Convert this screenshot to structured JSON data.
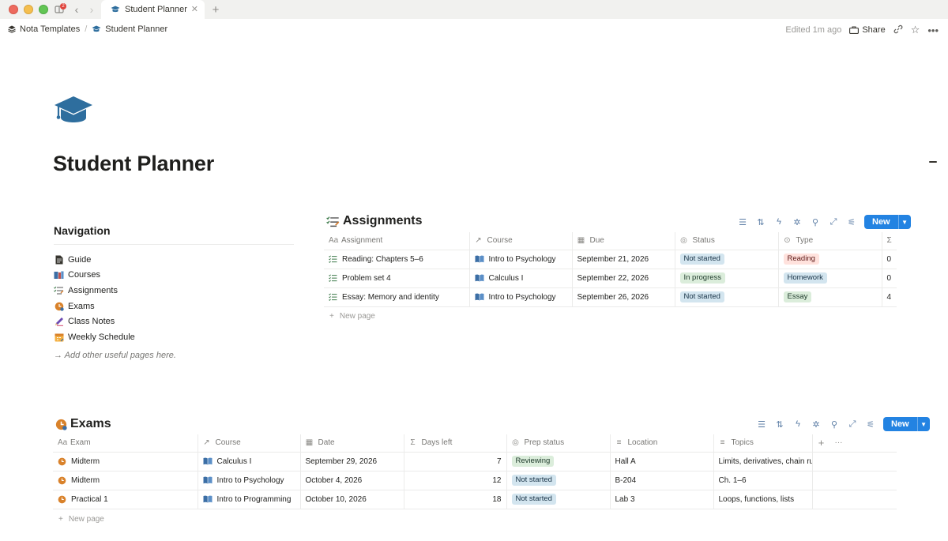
{
  "window": {
    "tab_title": "Student Planner",
    "notification_count": "2"
  },
  "breadcrumb": {
    "workspace": "Nota Templates",
    "page": "Student Planner"
  },
  "topbar": {
    "edited": "Edited 1m ago",
    "share_label": "Share"
  },
  "page": {
    "title": "Student Planner"
  },
  "navigation": {
    "heading": "Navigation",
    "items": [
      {
        "label": "Guide",
        "icon": "page-icon"
      },
      {
        "label": "Courses",
        "icon": "books-icon"
      },
      {
        "label": "Assignments",
        "icon": "checklist-icon"
      },
      {
        "label": "Exams",
        "icon": "exam-clock-icon"
      },
      {
        "label": "Class Notes",
        "icon": "pencil-icon"
      },
      {
        "label": "Weekly Schedule",
        "icon": "calendar-icon"
      }
    ],
    "hint": "→ Add other useful pages here."
  },
  "assignments": {
    "title": "Assignments",
    "new_label": "New",
    "new_page_label": "New page",
    "columns": [
      "Assignment",
      "Course",
      "Due",
      "Status",
      "Type",
      "Σ"
    ],
    "rows": [
      {
        "name": "Reading: Chapters 5–6",
        "course": "Intro to Psychology",
        "due": "September 21, 2026",
        "status": "Not started",
        "status_color": "#d3e5ef",
        "type": "Reading",
        "type_color": "#ffe2dd",
        "type_text": "#5d1715",
        "sum": "0"
      },
      {
        "name": "Problem set 4",
        "course": "Calculus I",
        "due": "September 22, 2026",
        "status": "In progress",
        "status_color": "#dbeddb",
        "type": "Homework",
        "type_color": "#d3e5ef",
        "type_text": "#183347",
        "sum": "0"
      },
      {
        "name": "Essay: Memory and identity",
        "course": "Intro to Psychology",
        "due": "September 26, 2026",
        "status": "Not started",
        "status_color": "#d3e5ef",
        "type": "Essay",
        "type_color": "#dbeddb",
        "type_text": "#1c3829",
        "sum": "4"
      }
    ]
  },
  "exams": {
    "title": "Exams",
    "new_label": "New",
    "new_page_label": "New page",
    "columns": [
      "Exam",
      "Course",
      "Date",
      "Days left",
      "Prep status",
      "Location",
      "Topics"
    ],
    "rows": [
      {
        "name": "Midterm",
        "course": "Calculus I",
        "date": "September 29, 2026",
        "days_left": "7",
        "prep": "Reviewing",
        "prep_color": "#dbeddb",
        "prep_text": "#1c3829",
        "location": "Hall A",
        "topics": "Limits, derivatives, chain rule"
      },
      {
        "name": "Midterm",
        "course": "Intro to Psychology",
        "date": "October 4, 2026",
        "days_left": "12",
        "prep": "Not started",
        "prep_color": "#d3e5ef",
        "prep_text": "#183347",
        "location": "B-204",
        "topics": "Ch. 1–6"
      },
      {
        "name": "Practical 1",
        "course": "Intro to Programming",
        "date": "October 10, 2026",
        "days_left": "18",
        "prep": "Not started",
        "prep_color": "#d3e5ef",
        "prep_text": "#183347",
        "location": "Lab 3",
        "topics": "Loops, functions, lists"
      }
    ]
  },
  "colors": {
    "accent": "#2383e2",
    "mortarboard": "#2e6e9e"
  }
}
